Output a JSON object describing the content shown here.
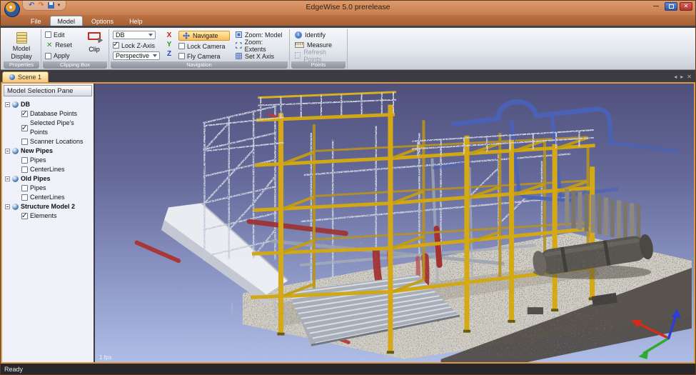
{
  "window": {
    "title": "EdgeWise 5.0 prerelease",
    "controls": {
      "minimize": "—",
      "close": "✕"
    },
    "qat": {
      "undo": "↶",
      "redo": "↷",
      "more": "▾"
    }
  },
  "menu": {
    "active_tab": "Model",
    "tabs": [
      {
        "label": "File"
      },
      {
        "label": "Model"
      },
      {
        "label": "Options"
      },
      {
        "label": "Help"
      }
    ]
  },
  "ribbon": {
    "properties": {
      "group_label": "Properties",
      "model_display": "Model Display"
    },
    "clipping_box": {
      "group_label": "Clipping Box",
      "edit": "Edit",
      "edit_checked": false,
      "reset": "Reset",
      "apply": "Apply",
      "apply_checked": false,
      "clip": "Clip"
    },
    "navigation": {
      "group_label": "Navigation",
      "view_dropdown": "DB",
      "lock_z_axis": "Lock Z-Axis",
      "lock_z_checked": true,
      "projection_dropdown": "Perspective",
      "axis_x": "X",
      "axis_y": "Y",
      "axis_z": "Z",
      "navigate": "Navigate",
      "navigate_active": true,
      "lock_camera": "Lock Camera",
      "lock_camera_checked": false,
      "fly_camera": "Fly Camera",
      "fly_camera_checked": false,
      "zoom_model": "Zoom: Model",
      "zoom_extents": "Zoom: Extents",
      "set_x_axis": "Set X Axis"
    },
    "points": {
      "group_label": "Points",
      "identify": "Identify",
      "measure": "Measure",
      "refresh_points": "Refresh Points",
      "refresh_enabled": false
    }
  },
  "tabs_bar": {
    "scene_tab": "Scene 1",
    "nav_prev": "◂",
    "nav_next": "▸",
    "close": "✕"
  },
  "pane": {
    "title": "Model Selection Pane",
    "tree": [
      {
        "label": "DB",
        "children": [
          {
            "label": "Database Points",
            "checked": true
          },
          {
            "label": "Selected Pipe's Points",
            "checked": true
          },
          {
            "label": "Scanner Locations",
            "checked": false
          }
        ]
      },
      {
        "label": "New Pipes",
        "children": [
          {
            "label": "Pipes",
            "checked": false
          },
          {
            "label": "CenterLines",
            "checked": false
          }
        ]
      },
      {
        "label": "Old Pipes",
        "children": [
          {
            "label": "Pipes",
            "checked": false
          },
          {
            "label": "CenterLines",
            "checked": false
          }
        ]
      },
      {
        "label": "Structure Model 2",
        "children": [
          {
            "label": "Elements",
            "checked": true
          }
        ]
      }
    ]
  },
  "viewport": {
    "fps": "1 fps",
    "background_top": "#50507c",
    "background_bottom": "#aebde6",
    "axis_gizmo_colors": {
      "x": "#d42a1e",
      "y": "#2faa2f",
      "z": "#2b3fd4"
    },
    "scene_description": "Point cloud of industrial plant: yellow steel frame, gray scaffolding, blue and red pipes, concrete slab, horizontal tank"
  },
  "status_bar": {
    "text": "Ready"
  },
  "theme": {
    "titlebar": "#c9825a",
    "ribbon_bg": "#e5e9ef",
    "scene_tab_bg": "#f2c97c",
    "viewport_border": "#d89848",
    "navigate_highlight": "#fbbd5e",
    "steel_yellow": "#d2a714",
    "pipe_blue": "#4a63b8",
    "pipe_red": "#a23232"
  }
}
